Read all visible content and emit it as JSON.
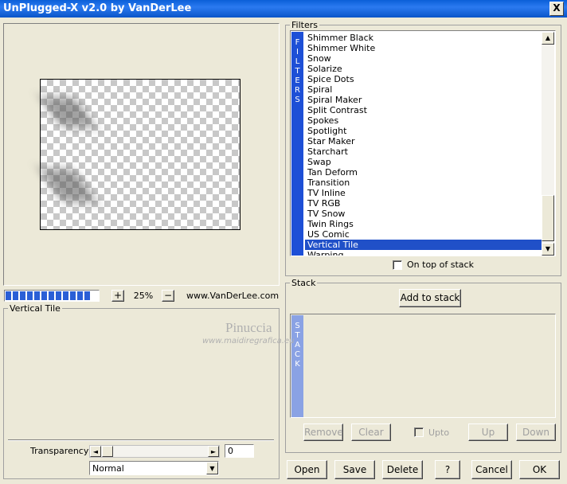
{
  "window": {
    "title": "UnPlugged-X v2.0 by VanDerLee",
    "close_glyph": "X"
  },
  "zoom": {
    "plus": "+",
    "value": "25%",
    "minus": "−",
    "website": "www.VanDerLee.com",
    "progress_segments": 12
  },
  "settings": {
    "title": "Vertical Tile"
  },
  "transparency": {
    "label": "Transparency",
    "value": "0",
    "left_arrow": "◄",
    "right_arrow": "►"
  },
  "blend": {
    "value": "Normal",
    "arrow": "▼"
  },
  "filters": {
    "label": "Filters",
    "tab_letters": [
      "F",
      "I",
      "L",
      "T",
      "E",
      "R",
      "S"
    ],
    "items": [
      "Shimmer Black",
      "Shimmer White",
      "Snow",
      "Solarize",
      "Spice Dots",
      "Spiral",
      "Spiral Maker",
      "Split Contrast",
      "Spokes",
      "Spotlight",
      "Star Maker",
      "Starchart",
      "Swap",
      "Tan Deform",
      "Transition",
      "TV Inline",
      "TV RGB",
      "TV Snow",
      "Twin Rings",
      "US Comic",
      "Vertical Tile",
      "Warping"
    ],
    "selected": "Vertical Tile",
    "on_top_label": "On top of stack",
    "scroll_up": "▲",
    "scroll_down": "▼"
  },
  "stack": {
    "label": "Stack",
    "add_button": "Add to stack",
    "tab_letters": [
      "S",
      "T",
      "A",
      "C",
      "K"
    ],
    "remove": "Remove",
    "clear": "Clear",
    "upto": "Upto",
    "up": "Up",
    "down": "Down"
  },
  "footer": {
    "open": "Open",
    "save": "Save",
    "delete": "Delete",
    "help": "?",
    "cancel": "Cancel",
    "ok": "OK"
  },
  "watermark": {
    "name": "Pinuccia",
    "url": "www.maidiregrafica.eu"
  }
}
